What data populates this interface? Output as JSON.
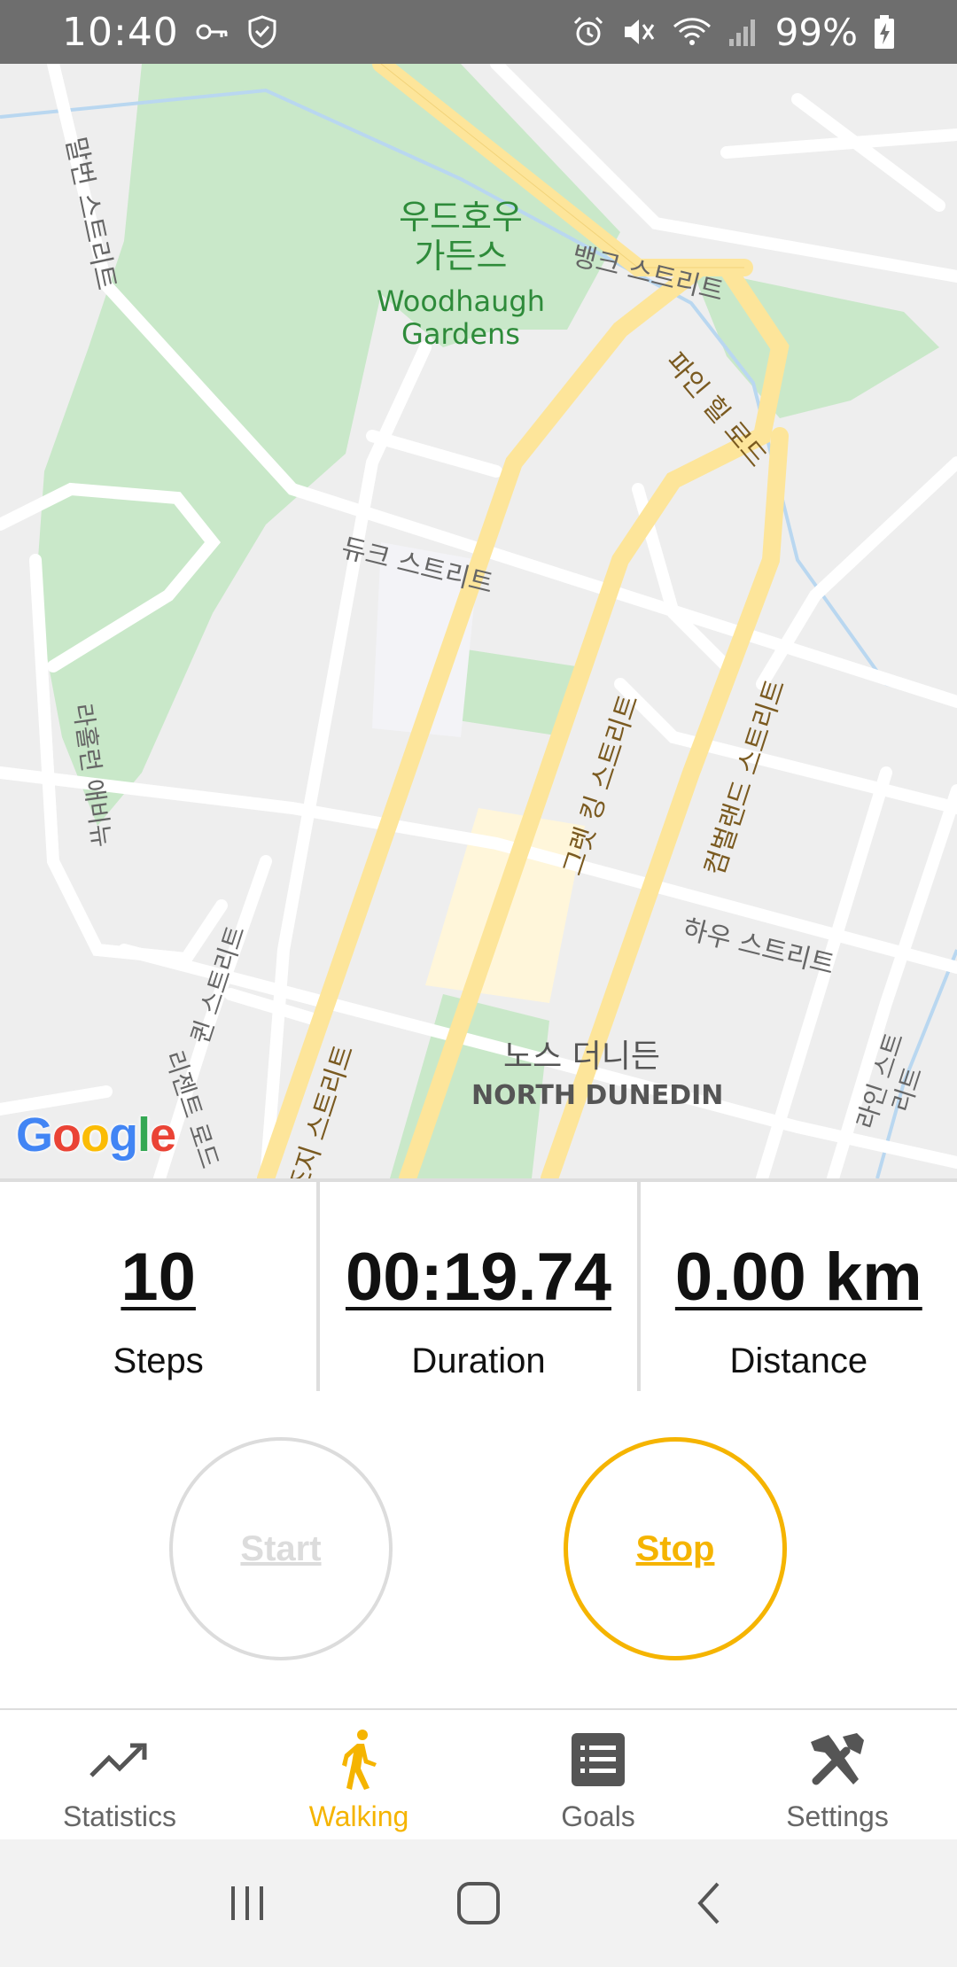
{
  "status_bar": {
    "time": "10:40",
    "battery_text": "99%",
    "icons_left": [
      "key-icon",
      "shield-icon"
    ],
    "icons_right": [
      "alarm-icon",
      "mute-icon",
      "wifi-icon",
      "signal-icon",
      "battery-charging-icon"
    ]
  },
  "map": {
    "labels": {
      "gardens_ko": "우드호우\n가든스",
      "gardens_en": "Woodhaugh\nGardens",
      "bank_st": "뱅크 스트리트",
      "pine_hill": "파인 힐 로드",
      "duke_st": "듀크 스트리트",
      "malvern_st": "말번 스트리트",
      "lavender_ave": "라홀런 애비뉴",
      "great_king": "그렛 킹 스트리트",
      "cumberland": "컴벌랜드 스트리트",
      "howe_st": "하우 스트리트",
      "george_st": "조지 스트리트",
      "north_dunedin_ko": "노스 더니든",
      "north_dunedin_en": "NORTH DUNEDIN",
      "queen_st": "퀸 스트리트",
      "regent_rd": "리젠트 로드",
      "london_st": "라인 스트리트"
    },
    "logo": "Google"
  },
  "stats": {
    "steps": {
      "value": "10",
      "label": "Steps"
    },
    "duration": {
      "value": "00:19.74",
      "label": "Duration"
    },
    "distance": {
      "value": "0.00 km",
      "label": "Distance"
    }
  },
  "controls": {
    "start_label": "Start",
    "stop_label": "Stop",
    "accent": "#F5B400"
  },
  "nav": {
    "items": [
      {
        "label": "Statistics",
        "icon": "trending-up-icon",
        "active": false
      },
      {
        "label": "Walking",
        "icon": "walking-icon",
        "active": true
      },
      {
        "label": "Goals",
        "icon": "list-icon",
        "active": false
      },
      {
        "label": "Settings",
        "icon": "tools-icon",
        "active": false
      }
    ]
  }
}
